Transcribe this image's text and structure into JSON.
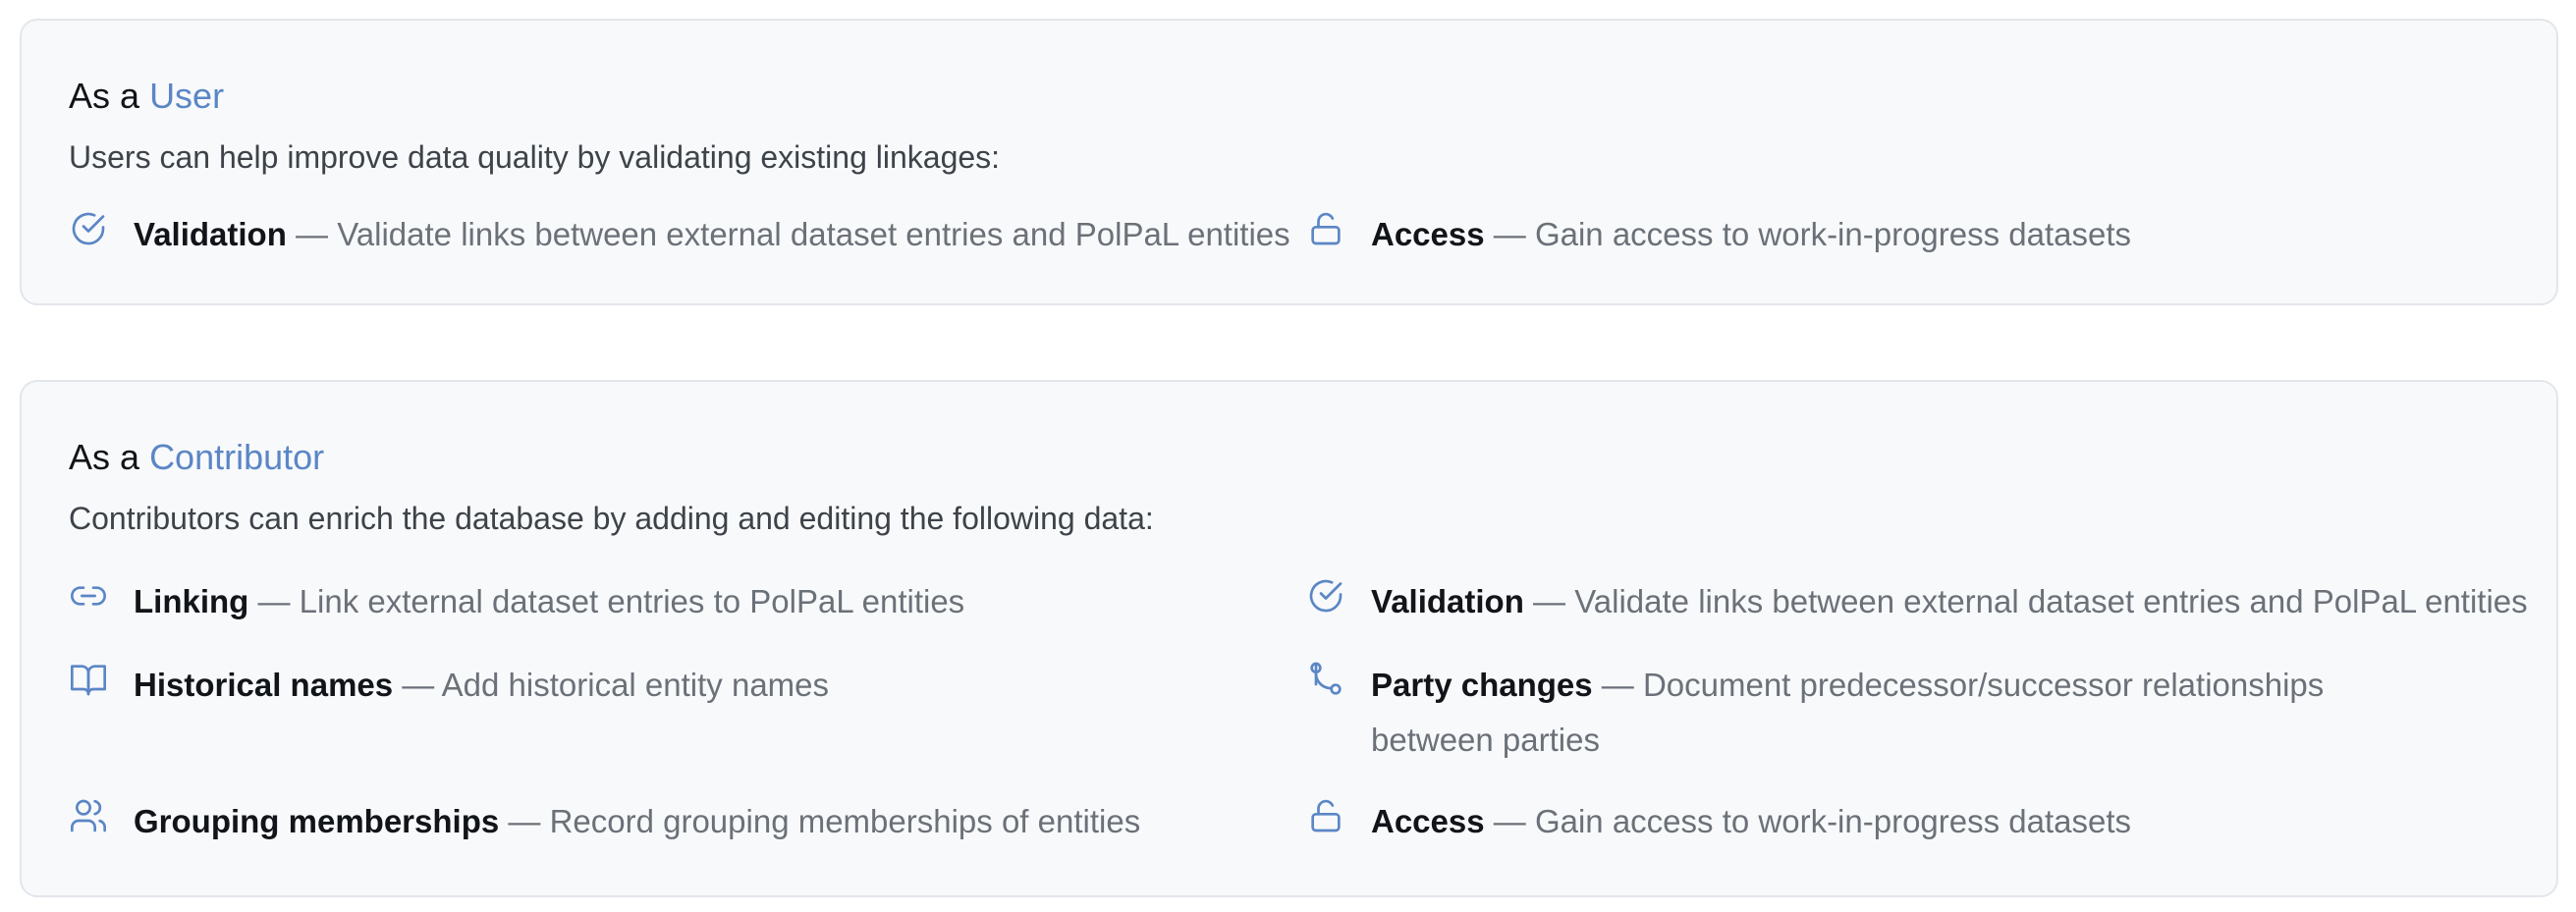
{
  "user_card": {
    "prefix": "As a",
    "role": "User",
    "description": "Users can help improve data quality by validating existing linkages:",
    "items": [
      {
        "icon": "check-circle-icon",
        "name": "Validation",
        "separator": "—",
        "text": "Validate links between external dataset entries and PolPaL entities"
      },
      {
        "icon": "unlock-icon",
        "name": "Access",
        "separator": "—",
        "text": "Gain access to work-in-progress datasets"
      }
    ]
  },
  "contributor_card": {
    "prefix": "As a",
    "role": "Contributor",
    "description": "Contributors can enrich the database by adding and editing the following data:",
    "items": [
      {
        "icon": "link-icon",
        "name": "Linking",
        "separator": "—",
        "text": "Link external dataset entries to PolPaL entities"
      },
      {
        "icon": "check-circle-icon",
        "name": "Validation",
        "separator": "—",
        "text": "Validate links between external dataset entries and PolPaL entities"
      },
      {
        "icon": "book-icon",
        "name": "Historical names",
        "separator": "—",
        "text": "Add historical entity names"
      },
      {
        "icon": "git-branch-icon",
        "name": "Party changes",
        "separator": "—",
        "text": "Document predecessor/successor relationships between parties"
      },
      {
        "icon": "users-icon",
        "name": "Grouping memberships",
        "separator": "—",
        "text": "Record grouping memberships of entities"
      },
      {
        "icon": "unlock-icon",
        "name": "Access",
        "separator": "—",
        "text": "Gain access to work-in-progress datasets"
      }
    ]
  },
  "colors": {
    "accent": "#5b86c5",
    "card_background": "#f8f9fb",
    "card_border": "#e3e6ea"
  }
}
